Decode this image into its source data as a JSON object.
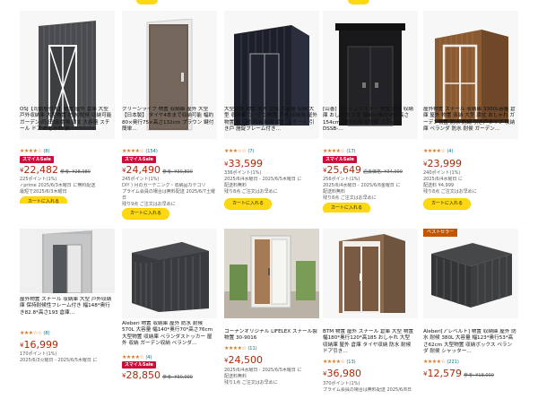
{
  "colors": {
    "accent": "#ffd814",
    "price": "#b12704",
    "sale": "#cc0c39",
    "star": "#de7921",
    "link": "#007185"
  },
  "top_row": [
    {
      "name": "p1",
      "title": "OSJ【司動梱付木】物置 屋外 倉庫 大型 戸外収納庫 大型物置 防水/耐侯 収納可能 ガーデン/庭/田畑/農場 頑丈 大容量 スチール ドア おしゃれ 狭…",
      "stars": "★★★★☆",
      "rating_count": "(8)",
      "sale": "スマイルSale",
      "price": "22,482",
      "ref_price": "参考: ¥28,980",
      "points": "225ポイント(1%)",
      "info": [
        {
          "t": "✓prime 2025/6/3木曜日 に無料配送"
        },
        {
          "t": "最短で2025/6/3木曜日"
        }
      ],
      "cart": "カートに入れる"
    },
    {
      "name": "p2",
      "title": "グリーンライフ 物置 収納庫 屋外 大型 【日本製】 タイヤ4本まで収納可能 幅約80×奥行75×高さ132cm ブラウン 鍵付 簡単…",
      "stars": "★★★★☆",
      "rating_count": "(154)",
      "sale": "スマイルSale",
      "price": "24,490",
      "ref_price": "参考: ¥30,800",
      "points": "245ポイント(1%)",
      "info": [
        {
          "t": "DIY ) 月のガーデニング・収納品カテゴリ"
        },
        {
          "t": "プライム会員の場合は無料配送 2025/6/7土曜日"
        },
        {
          "t": "残り9点 ご注文はお早めに"
        }
      ],
      "cart": "カートに入れる"
    },
    {
      "name": "p3",
      "title": "大型物置 物置 屋外 倉庫 大容量 収納 大型 収納庫 ガーデン物置 戸外 収納用 屋外物置 耐天候 防水 耐侯 頑丈 スチール 引き戸 施錠フレーム付き…",
      "stars": "★★★☆☆",
      "rating_count": "(7)",
      "sale": "",
      "price": "33,599",
      "ref_price": "",
      "points": "336ポイント(1%)",
      "info": [
        {
          "t": "2025/6/4水曜日 - 2025/6/5木曜日 に"
        },
        {
          "t": "配送料無料"
        },
        {
          "t": "残り8点 ご注文はお早めに"
        }
      ],
      "cart": "カートに入れる"
    },
    {
      "name": "p4",
      "title": "[山善] ガーデンマスター 物置 屋外 収納庫 おしゃれ 大型 幅90×奥行45×高さ154cm 鍵付き/有効耐錆 ブラック DSSB-…",
      "stars": "★★★★☆",
      "rating_count": "(17)",
      "sale": "スマイルSale",
      "price": "25,649",
      "ref_price": "過去価格: ¥34,000",
      "points": "256ポイント(1%)",
      "info": [
        {
          "t": "2025/6/4水曜日 - 2025/6/6金曜日 に"
        },
        {
          "t": "配送料無料"
        },
        {
          "t": "残り8点 ご注文はお早めに"
        }
      ],
      "cart": "カートに入れる"
    },
    {
      "name": "p5",
      "title": "屋外物置 スチール 収納庫 3300L容量 倉庫 屋外 物置 収納 大型 頑丈 おしゃれ ガーデン物置 防水 防錆 引き戸タイプ 収納庫 ベランダ 防水 耐侯 ガーデン…",
      "stars": "★★★★☆",
      "rating_count": "(4)",
      "sale": "",
      "price": "23,999",
      "ref_price": "",
      "points": "240ポイント(1%)",
      "info": [
        {
          "t": "2025/6/4水曜日 に"
        },
        {
          "t": "配送料 ¥4,999"
        },
        {
          "t": "残り8点 ご注文はお早めに"
        }
      ],
      "cart": "カートに入れる"
    }
  ],
  "bottom_row": [
    {
      "name": "p6",
      "title": "屋外物置 スチール 収納庫 大型 戸外収納庫 保持耐候性フレーム付き 幅148*奥行き82.8*高さ193 倉庫…",
      "stars": "★★★☆☆",
      "rating_count": "(8)",
      "price": "16,999",
      "points": "170ポイント(1%)",
      "info": [
        {
          "t": "2025/6/3火曜日 - 2025/6/5木曜日 に"
        }
      ]
    },
    {
      "name": "p7",
      "title": "Aleberi 物置 収納庫 屋外 防水 耐候 570L 大容量 幅140*奥行70*高さ76cm 大型物置 収納庫 ベランダストッカー 屋外 収納 ガーデン収納 ベランダ…",
      "stars": "★★★★☆",
      "rating_count": "(4)",
      "sale": "スマイルSale",
      "price": "28,850",
      "ref_price": "参考: ¥30,000",
      "info": []
    },
    {
      "name": "p8",
      "title": "コーナンオリジナル LIFELEX スチール製物置 30-9016",
      "stars": "★★★★☆",
      "rating_count": "(11)",
      "price": "24,500",
      "points": "",
      "info": [
        {
          "t": "2025/6/4水曜日 - 2025/6/5木曜日 に"
        },
        {
          "t": "配送料無料"
        },
        {
          "t": "残り1点 ご注文はお早めに"
        }
      ]
    },
    {
      "name": "p9",
      "title": "BTM 物置 屋外 スチール 倉庫 大型 物置 幅180*奥行120*高185 おしゃれ 大型 収納庫 屋外 倉庫 タイヤ収納 防水 耐候 ドア引き…",
      "stars": "★★★★☆",
      "rating_count": "(13)",
      "price": "36,980",
      "points": "370ポイント(1%)",
      "info": [
        {
          "t": "プライム会員の場合は無料配送 2025/6/8日"
        }
      ]
    },
    {
      "name": "p10",
      "title": "Aleberi[アレベルト] 物置 収納庫 屋外 防水 耐候 380L 大容量 幅123*奥行53*高さ62cm 大型物置 収納ボックス ベランダ 耐侯 シャッター…",
      "stars": "★★★★☆",
      "rating_count": "(221)",
      "best": "ベストセラー",
      "price": "12,579",
      "ref_price": "参考: ¥18,000",
      "info": []
    }
  ]
}
